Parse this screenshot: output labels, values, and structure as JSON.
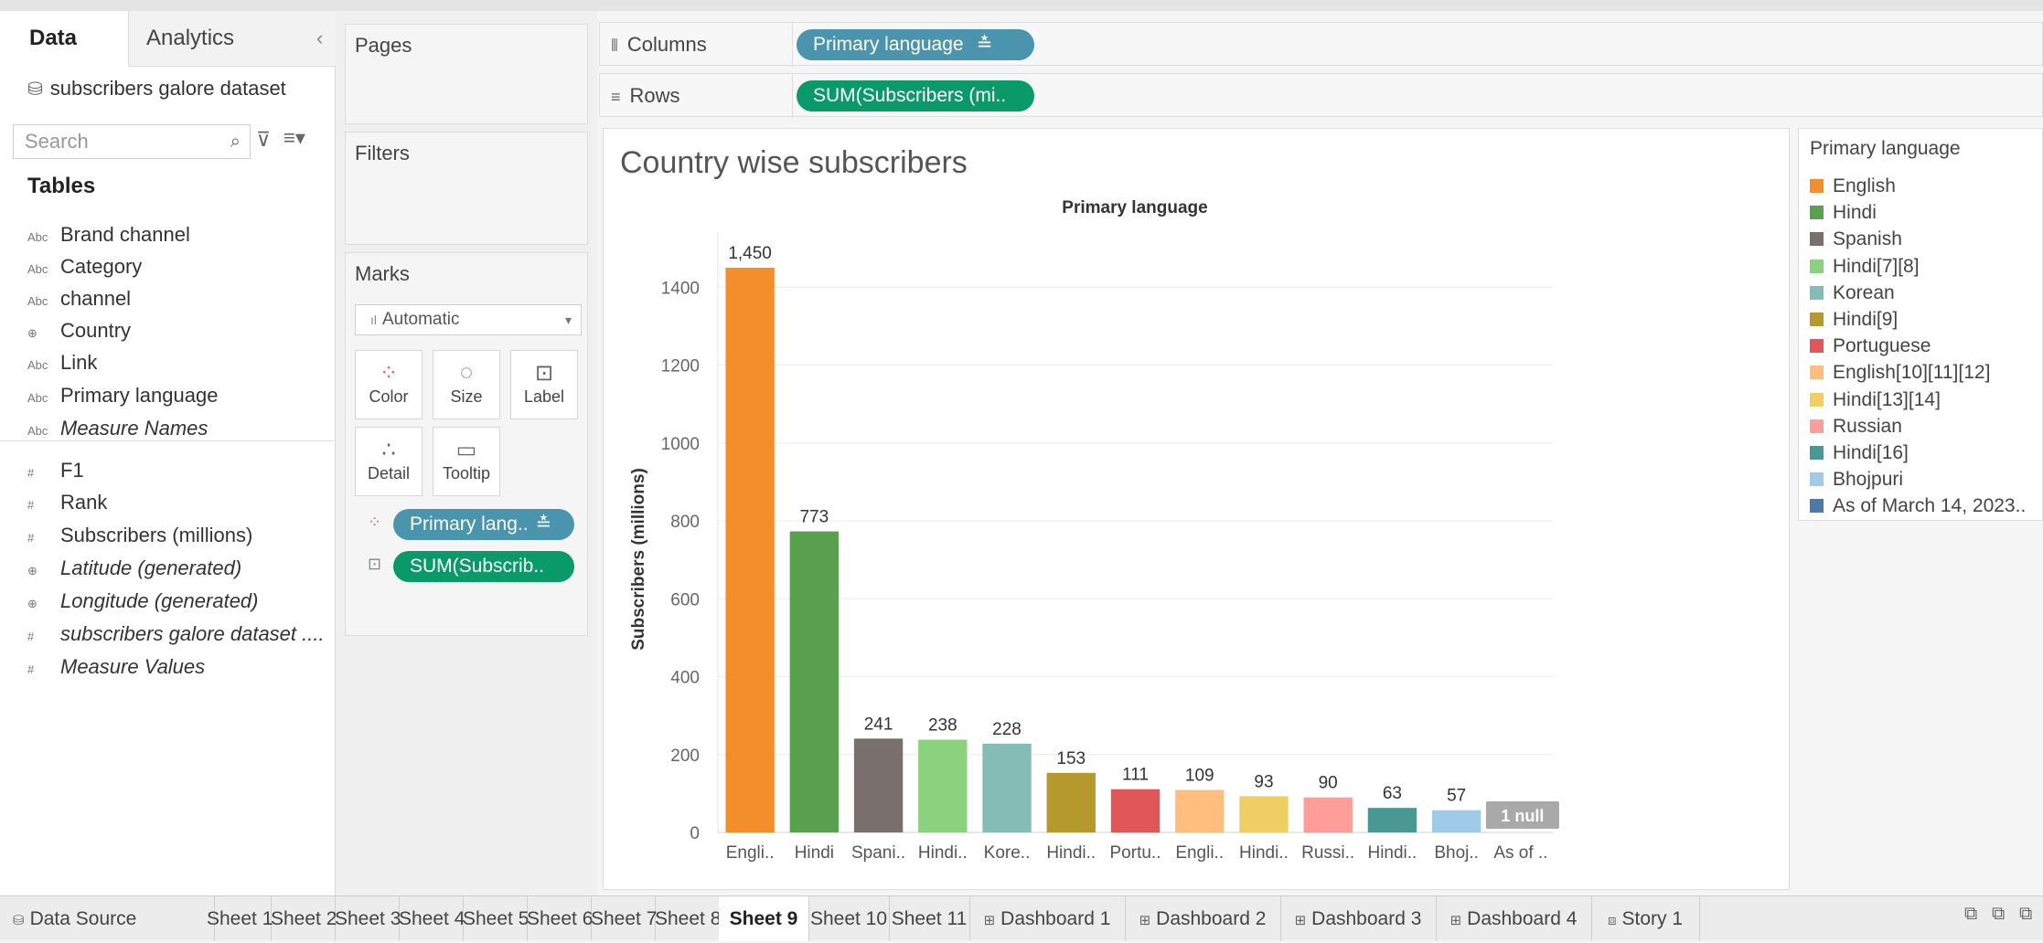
{
  "data_pane": {
    "tab_data": "Data",
    "tab_analytics": "Analytics",
    "collapse_glyph": "‹",
    "datasource": "subscribers galore dataset",
    "search_placeholder": "Search",
    "tables_header": "Tables",
    "fields": [
      {
        "type_glyph": "Abc",
        "name": "Brand channel",
        "italic": false
      },
      {
        "type_glyph": "Abc",
        "name": "Category",
        "italic": false
      },
      {
        "type_glyph": "Abc",
        "name": "channel",
        "italic": false
      },
      {
        "type_glyph": "⊕",
        "name": "Country",
        "italic": false
      },
      {
        "type_glyph": "Abc",
        "name": "Link",
        "italic": false
      },
      {
        "type_glyph": "Abc",
        "name": "Primary language",
        "italic": false
      },
      {
        "type_glyph": "Abc",
        "name": "Measure Names",
        "italic": true
      },
      {
        "type_glyph": "#",
        "name": "F1",
        "italic": false
      },
      {
        "type_glyph": "#",
        "name": "Rank",
        "italic": false
      },
      {
        "type_glyph": "#",
        "name": "Subscribers (millions)",
        "italic": false
      },
      {
        "type_glyph": "⊕",
        "name": "Latitude (generated)",
        "italic": true
      },
      {
        "type_glyph": "⊕",
        "name": "Longitude (generated)",
        "italic": true
      },
      {
        "type_glyph": "#",
        "name": "subscribers galore dataset ....",
        "italic": true
      },
      {
        "type_glyph": "#",
        "name": "Measure Values",
        "italic": true
      }
    ]
  },
  "shelves": {
    "pages": "Pages",
    "filters": "Filters",
    "marks": "Marks",
    "mark_type": "Automatic",
    "mark_buttons": [
      "Color",
      "Size",
      "Label",
      "Detail",
      "Tooltip"
    ],
    "mark_pills": [
      "Primary lang..",
      "SUM(Subscrib.."
    ],
    "columns_label": "Columns",
    "rows_label": "Rows",
    "columns_pill": "Primary language",
    "rows_pill": "SUM(Subscribers (mi.."
  },
  "viz": {
    "title": "Country wise subscribers",
    "header": "Primary language",
    "null_indicator": "1 null"
  },
  "chart_data": {
    "type": "bar",
    "title": "Country wise subscribers",
    "xlabel": "Primary language",
    "ylabel": "Subscribers (millions)",
    "ylim": [
      0,
      1450
    ],
    "yticks": [
      0,
      200,
      400,
      600,
      800,
      1000,
      1200,
      1400
    ],
    "grid": true,
    "categories": [
      "Engli..",
      "Hindi",
      "Spani..",
      "Hindi..",
      "Kore..",
      "Hindi..",
      "Portu..",
      "Engli..",
      "Hindi..",
      "Russi..",
      "Hindi..",
      "Bhoj..",
      "As of .."
    ],
    "values": [
      1450,
      773,
      241,
      238,
      228,
      153,
      111,
      109,
      93,
      90,
      63,
      57,
      null
    ],
    "value_labels": [
      "1,450",
      "773",
      "241",
      "238",
      "228",
      "153",
      "111",
      "109",
      "93",
      "90",
      "63",
      "57",
      ""
    ],
    "colors": [
      "#f28e2b",
      "#59a14f",
      "#79706e",
      "#8cd17d",
      "#86bcb6",
      "#b6992d",
      "#e15759",
      "#ffbe7d",
      "#f1ce63",
      "#ff9d9a",
      "#499894",
      "#a0cbe8",
      "#4e79a7"
    ],
    "legend": {
      "title": "Primary language",
      "placement": "right",
      "items": [
        "English",
        "Hindi",
        "Spanish",
        "Hindi[7][8]",
        "Korean",
        "Hindi[9]",
        "Portuguese",
        "English[10][11][12]",
        "Hindi[13][14]",
        "Russian",
        "Hindi[16]",
        "Bhojpuri",
        "As of March 14, 2023.."
      ]
    }
  },
  "sheet_tabs": {
    "data_source": "Data Source",
    "tabs": [
      {
        "label": "Sheet 1",
        "kind": "sheet"
      },
      {
        "label": "Sheet 2",
        "kind": "sheet"
      },
      {
        "label": "Sheet 3",
        "kind": "sheet"
      },
      {
        "label": "Sheet 4",
        "kind": "sheet"
      },
      {
        "label": "Sheet 5",
        "kind": "sheet"
      },
      {
        "label": "Sheet 6",
        "kind": "sheet"
      },
      {
        "label": "Sheet 7",
        "kind": "sheet"
      },
      {
        "label": "Sheet 8",
        "kind": "sheet"
      },
      {
        "label": "Sheet 9",
        "kind": "sheet",
        "active": true
      },
      {
        "label": "Sheet 10",
        "kind": "sheet"
      },
      {
        "label": "Sheet 11",
        "kind": "sheet"
      },
      {
        "label": "Dashboard 1",
        "kind": "dashboard"
      },
      {
        "label": "Dashboard 2",
        "kind": "dashboard"
      },
      {
        "label": "Dashboard 3",
        "kind": "dashboard"
      },
      {
        "label": "Dashboard 4",
        "kind": "dashboard"
      },
      {
        "label": "Story 1",
        "kind": "story"
      }
    ]
  }
}
